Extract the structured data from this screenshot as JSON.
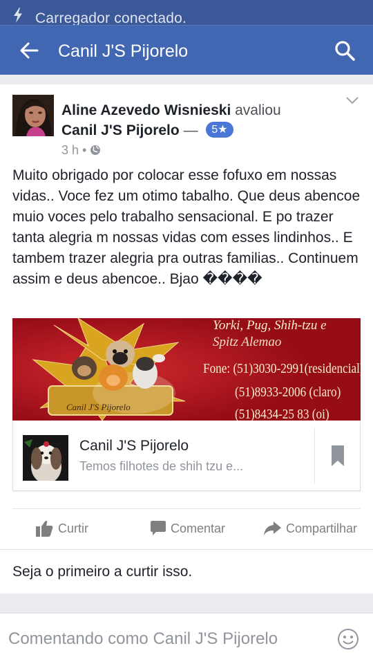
{
  "status_bar": {
    "text": "Carregador conectado."
  },
  "app_bar": {
    "title": "Canil J'S Pijorelo"
  },
  "post": {
    "author": "Aline Azevedo Wisnieski",
    "verb": "avaliou",
    "page_name": "Canil J'S Pijorelo",
    "separator": "—",
    "rating": "5★",
    "time": "3 h",
    "dot": "•",
    "text": "Muito obrigado por colocar esse fofuxo em nossas vidas.. Voce fez um otimo tabalho. Que deus abencoe muio voces pelo trabalho sensacional. E po trazer tanta alegria m nossas vidas com esses lindinhos.. E tambem trazer alegria pra outras familias.. Continuem assim e deus abencoe.. Bjao ����"
  },
  "link_image": {
    "breeds_line": "Yorki, Pug, Shih-tzu e",
    "spitz_line": "Spitz Alemao",
    "phone_1": "Fone: (51)3030-2991(residencial)",
    "phone_2": "(51)8933-2006 (claro)",
    "phone_3": "(51)8434-25 83 (oi)",
    "logo_text": "Canil J'S Pijorelo"
  },
  "link_preview": {
    "title": "Canil J'S Pijorelo",
    "description": "Temos filhotes de shih tzu e..."
  },
  "actions": {
    "like": "Curtir",
    "comment": "Comentar",
    "share": "Compartilhar"
  },
  "likes_text": "Seja o primeiro a curtir isso.",
  "comment_box": {
    "placeholder": "Comentando como Canil J'S Pijorelo"
  },
  "colors": {
    "status_bar": "#3b5998",
    "app_bar": "#4267b2",
    "rating_badge": "#4a76d5",
    "banner_red": "#a7121c",
    "banner_gold": "#d9a420"
  },
  "icons": {
    "status": "charging-bolt-icon",
    "back": "arrow-left-icon",
    "search": "search-icon",
    "menu": "chevron-down-icon",
    "privacy": "globe-icon",
    "like": "thumbs-up-icon",
    "comment": "speech-bubble-icon",
    "share": "share-arrow-icon",
    "save": "bookmark-icon",
    "emoji": "smiley-icon"
  }
}
